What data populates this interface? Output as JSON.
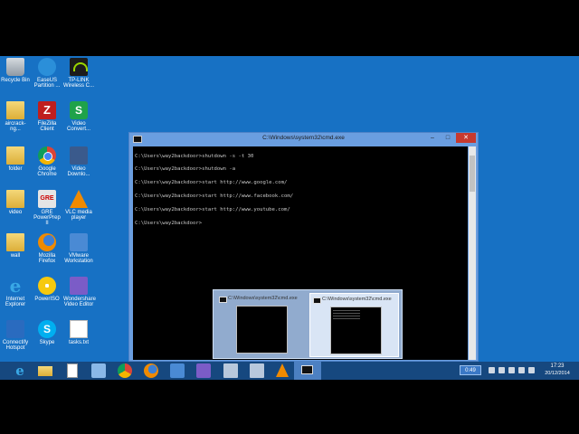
{
  "desktop": {
    "icons": [
      {
        "label": "Recycle Bin"
      },
      {
        "label": "EaseUS Partition ..."
      },
      {
        "label": "TP-LINK Wireless C..."
      },
      {
        "label": "aircrack-ng..."
      },
      {
        "label": "FileZilla Client"
      },
      {
        "label": "Video Convert..."
      },
      {
        "label": "folder"
      },
      {
        "label": "Google Chrome"
      },
      {
        "label": "Video Downlo..."
      },
      {
        "label": "video"
      },
      {
        "label": "GRE PowerPrep II"
      },
      {
        "label": "VLC media player"
      },
      {
        "label": "wall"
      },
      {
        "label": "Mozilla Firefox"
      },
      {
        "label": "VMware Workstation"
      },
      {
        "label": "Internet Explorer"
      },
      {
        "label": "PowerISO"
      },
      {
        "label": "Wondershare Video Editor"
      },
      {
        "label": "Connectify Hotspot"
      },
      {
        "label": "Skype"
      },
      {
        "label": "tasks.txt"
      }
    ]
  },
  "cmd_window": {
    "title": "C:\\Windows\\system32\\cmd.exe",
    "buttons": {
      "minimize": "–",
      "maximize": "□",
      "close": "✕"
    },
    "lines": [
      "C:\\Users\\way2backdoor>shutdown -s -t 30",
      "C:\\Users\\way2backdoor>shutdown -a",
      "C:\\Users\\way2backdoor>start http://www.google.com/",
      "C:\\Users\\way2backdoor>start http://www.facebook.com/",
      "C:\\Users\\way2backdoor>start http://www.youtube.com/",
      "C:\\Users\\way2backdoor>"
    ]
  },
  "preview": {
    "thumbs": [
      {
        "title": "C:\\Windows\\system32\\cmd.exe"
      },
      {
        "title": "C:\\Windows\\system32\\cmd.exe"
      }
    ]
  },
  "taskbar": {
    "tray_badge": "0:49",
    "time": "17:23",
    "date": "20/12/2014"
  },
  "icons": {
    "taskbar": [
      "internet-explorer-icon",
      "file-explorer-icon",
      "document-icon",
      "box-icon",
      "chrome-icon",
      "firefox-icon",
      "vmware-icon",
      "wondershare-icon",
      "network-icon",
      "network-icon",
      "vlc-icon",
      "cmd-icon"
    ]
  },
  "colors": {
    "desktop": "#1771c4",
    "taskbar": "#16487f",
    "window_frame": "#6a9ee0",
    "close_button": "#c7392e"
  }
}
